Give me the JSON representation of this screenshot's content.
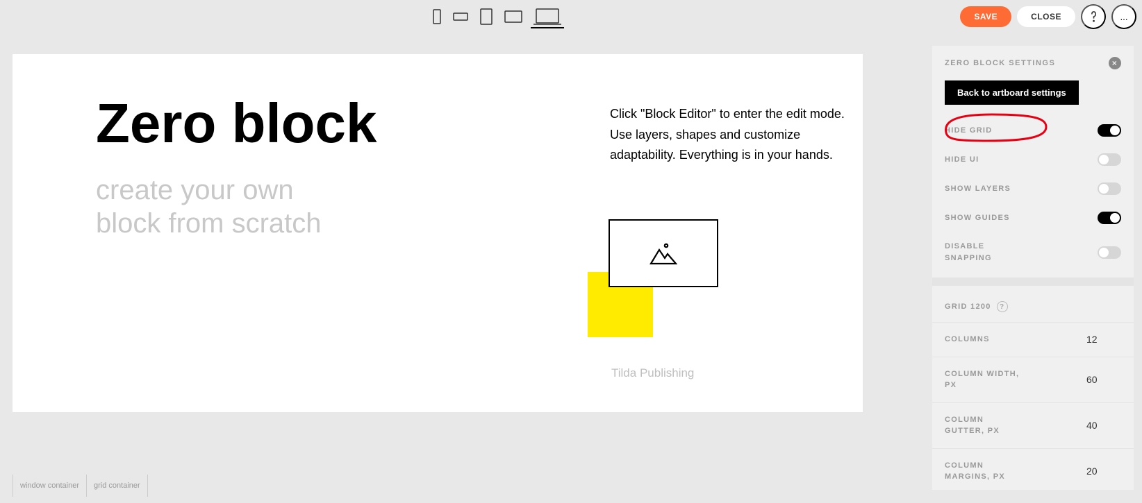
{
  "toolbar": {
    "save_label": "SAVE",
    "close_label": "CLOSE"
  },
  "artboard": {
    "title": "Zero block",
    "subtitle_line1": "create your own",
    "subtitle_line2": "block from scratch",
    "description": "Click \"Block Editor\" to enter the edit mode. Use layers, shapes and customize adaptability. Everything is in your hands.",
    "credit": "Tilda Publishing"
  },
  "status": {
    "window_container": "window container",
    "grid_container": "grid container"
  },
  "panel": {
    "title": "ZERO BLOCK SETTINGS",
    "back_label": "Back to artboard settings",
    "toggles": {
      "hide_grid": {
        "label": "HIDE GRID",
        "on": true
      },
      "hide_ui": {
        "label": "HIDE UI",
        "on": false
      },
      "show_layers": {
        "label": "SHOW LAYERS",
        "on": false
      },
      "show_guides": {
        "label": "SHOW GUIDES",
        "on": true
      },
      "disable_snapping": {
        "label": "DISABLE SNAPPING",
        "on": false
      }
    },
    "grid_heading": "GRID 1200",
    "grid_inputs": {
      "columns": {
        "label": "COLUMNS",
        "value": "12"
      },
      "column_width": {
        "label": "COLUMN WIDTH, PX",
        "value": "60"
      },
      "column_gutter": {
        "label": "COLUMN GUTTER, PX",
        "value": "40"
      },
      "column_margins": {
        "label": "COLUMN MARGINS, PX",
        "value": "20"
      }
    }
  }
}
